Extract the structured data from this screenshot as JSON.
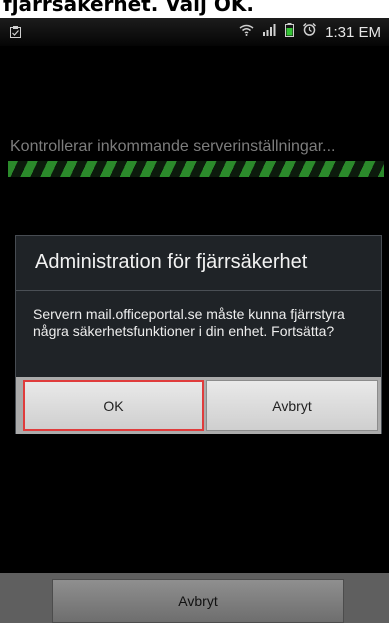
{
  "caption": "fjärrsäkerhet. Välj OK.",
  "status_bar": {
    "time": "1:31 EM",
    "icons": [
      "notification-icon",
      "wifi-icon",
      "signal-icon",
      "battery-icon",
      "alarm-icon"
    ]
  },
  "progress": {
    "text": "Kontrollerar inkommande serverinställningar..."
  },
  "dialog": {
    "title": "Administration för fjärrsäkerhet",
    "message": "Servern mail.officeportal.se måste kunna fjärrstyra några säkerhetsfunktioner i din enhet. Fortsätta?",
    "ok_label": "OK",
    "cancel_label": "Avbryt"
  },
  "bottom_bar": {
    "cancel_label": "Avbryt"
  },
  "colors": {
    "progress_green": "#2b8a2b",
    "highlight_red": "#e03c3c",
    "dialog_bg": "#1f2327"
  }
}
